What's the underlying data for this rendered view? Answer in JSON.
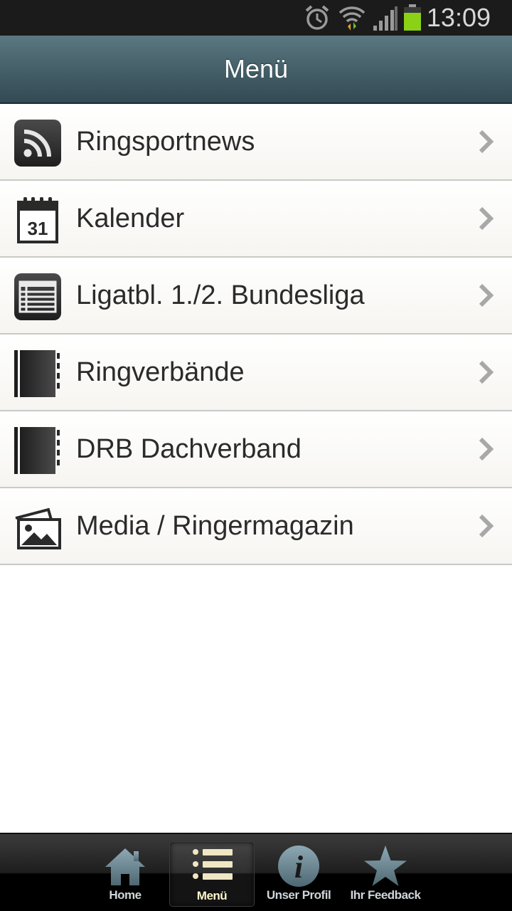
{
  "status_bar": {
    "time": "13:09",
    "icons": [
      "alarm-icon",
      "wifi-icon",
      "signal-icon",
      "battery-icon"
    ],
    "battery_color": "#8bd116"
  },
  "header": {
    "title": "Menü"
  },
  "menu": {
    "items": [
      {
        "label": "Ringsportnews",
        "icon": "rss-icon"
      },
      {
        "label": "Kalender",
        "icon": "calendar-icon",
        "icon_text": "31"
      },
      {
        "label": "Ligatbl. 1./2. Bundesliga",
        "icon": "list-table-icon"
      },
      {
        "label": "Ringverbände",
        "icon": "notebook-icon"
      },
      {
        "label": "DRB Dachverband",
        "icon": "notebook-icon"
      },
      {
        "label": "Media / Ringermagazin",
        "icon": "photos-icon"
      }
    ]
  },
  "tab_bar": {
    "tabs": [
      {
        "label": "Home",
        "icon": "home-icon",
        "active": false
      },
      {
        "label": "Menü",
        "icon": "menu-list-icon",
        "active": true
      },
      {
        "label": "Unser Profil",
        "icon": "info-icon",
        "active": false
      },
      {
        "label": "Ihr Feedback",
        "icon": "star-icon",
        "active": false
      }
    ]
  }
}
